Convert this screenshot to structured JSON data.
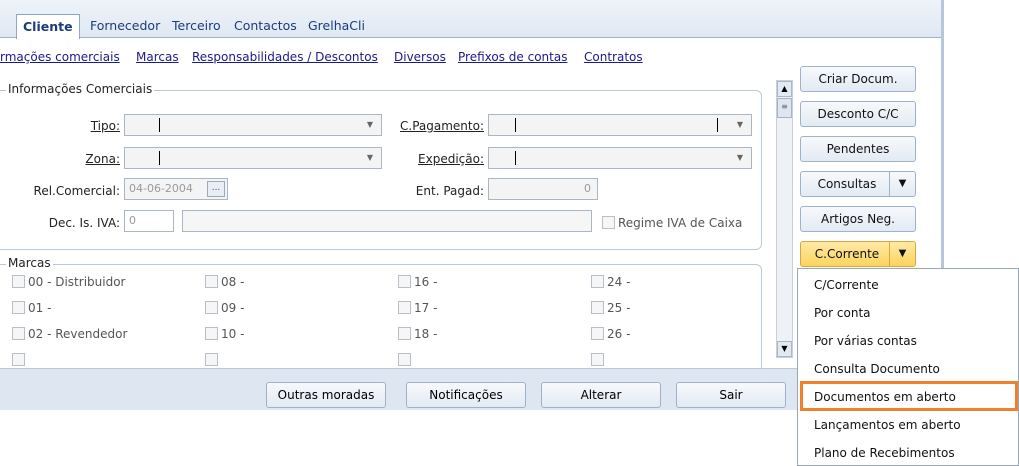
{
  "tabs": [
    "Cliente",
    "Fornecedor",
    "Terceiro",
    "Contactos",
    "GrelhaCli"
  ],
  "subnav": [
    "rmações comerciais",
    "Marcas",
    "Responsabilidades / Descontos",
    "Diversos",
    "Prefixos de contas",
    "Contratos"
  ],
  "info_group": {
    "title": "Informações Comerciais",
    "tipo_label": "Tipo:",
    "zona_label": "Zona:",
    "rel_label": "Rel.Comercial:",
    "rel_value": "04-06-2004",
    "ellipsis": "...",
    "deciva_label": "Dec. Is. IVA:",
    "deciva_value": "0",
    "cpag_label": "C.Pagamento:",
    "exped_label": "Expedição:",
    "entpag_label": "Ent. Pagad:",
    "entpag_value": "0",
    "regime_label": "Regime IVA de Caixa"
  },
  "marcas_group": {
    "title": "Marcas",
    "items": [
      "00 - Distribuidor",
      "08 -",
      "16 -",
      "24 -",
      "01 -",
      "09 -",
      "17 -",
      "25 -",
      "02 - Revendedor",
      "10 -",
      "18 -",
      "26 -"
    ]
  },
  "right_buttons": [
    "Criar Docum.",
    "Desconto C/C",
    "Pendentes",
    "Consultas",
    "Artigos Neg.",
    "C.Corrente"
  ],
  "bottom_buttons": [
    "Outras moradas",
    "Notificações",
    "Alterar",
    "Sair"
  ],
  "menu": {
    "items": [
      "C/Corrente",
      "Por conta",
      "Por várias contas",
      "Consulta Documento",
      "Documentos em aberto",
      "Lançamentos em aberto",
      "Plano de Recebimentos"
    ],
    "highlighted": "Documentos em aberto"
  },
  "colors": {
    "highlight": "#f07f2e",
    "active_button": "#fbd45e",
    "accent_blue": "#1a3c7a"
  }
}
